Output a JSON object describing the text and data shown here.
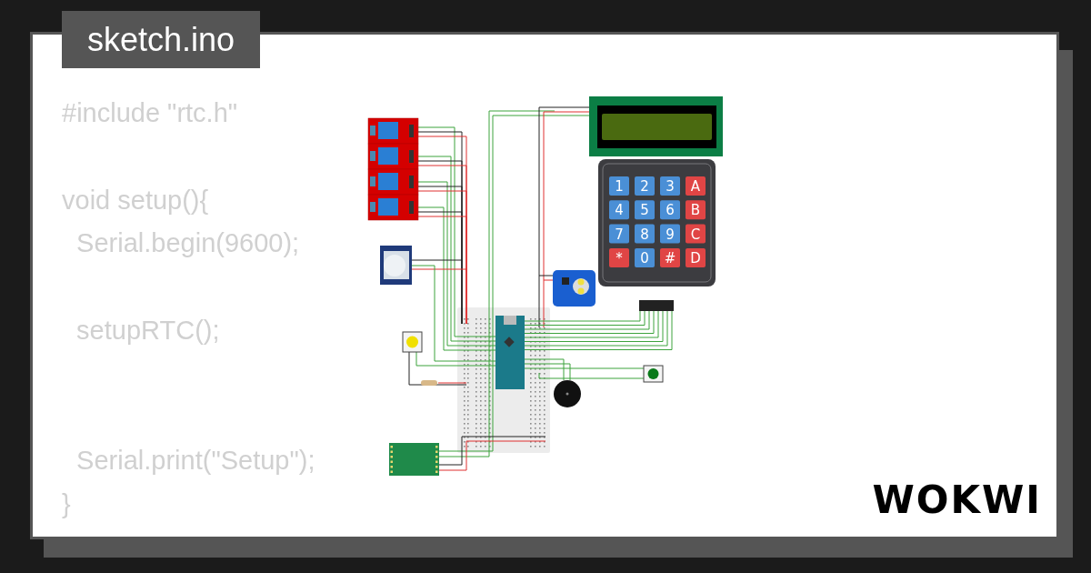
{
  "file_tab": {
    "title": "sketch.ino"
  },
  "code": [
    {
      "kind": "line",
      "text": "#include \"rtc.h\""
    },
    {
      "kind": "blank"
    },
    {
      "kind": "line",
      "text": "void setup(){"
    },
    {
      "kind": "line",
      "text": "  Serial.begin(9600);"
    },
    {
      "kind": "blank"
    },
    {
      "kind": "line",
      "text": "  setupRTC();"
    },
    {
      "kind": "blank"
    },
    {
      "kind": "blank"
    },
    {
      "kind": "line",
      "text": "  Serial.print(\"Setup\");"
    },
    {
      "kind": "line",
      "text": "}"
    }
  ],
  "circuit": {
    "keypad": {
      "keys": [
        {
          "label": "1",
          "color": "#4a8fd6"
        },
        {
          "label": "2",
          "color": "#4a8fd6"
        },
        {
          "label": "3",
          "color": "#4a8fd6"
        },
        {
          "label": "A",
          "color": "#e04545"
        },
        {
          "label": "4",
          "color": "#4a8fd6"
        },
        {
          "label": "5",
          "color": "#4a8fd6"
        },
        {
          "label": "6",
          "color": "#4a8fd6"
        },
        {
          "label": "B",
          "color": "#e04545"
        },
        {
          "label": "7",
          "color": "#4a8fd6"
        },
        {
          "label": "8",
          "color": "#4a8fd6"
        },
        {
          "label": "9",
          "color": "#4a8fd6"
        },
        {
          "label": "C",
          "color": "#e04545"
        },
        {
          "label": "*",
          "color": "#e04545"
        },
        {
          "label": "0",
          "color": "#4a8fd6"
        },
        {
          "label": "#",
          "color": "#e04545"
        },
        {
          "label": "D",
          "color": "#e04545"
        }
      ]
    }
  },
  "logo": {
    "text": "WOKWI"
  }
}
